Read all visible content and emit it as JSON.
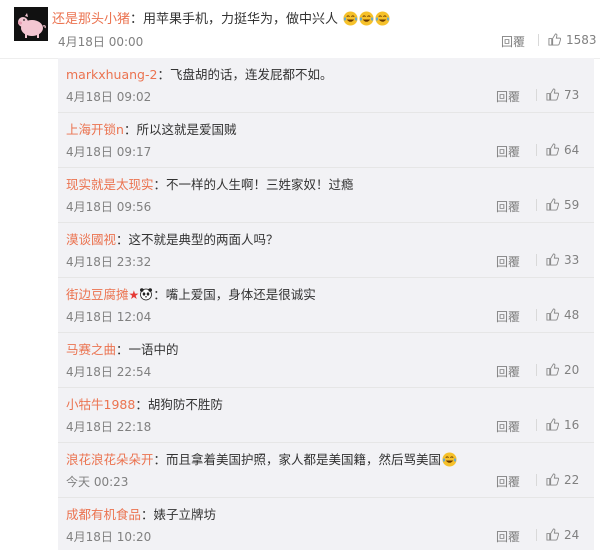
{
  "main_comment": {
    "user": "还是那头小猪",
    "text": "：用苹果手机，力挺华为，做中兴人",
    "time": "4月18日 00:00",
    "reply_label": "回覆",
    "likes": "1583",
    "avatar_icon": "pig-avatar-icon",
    "emoji_icon": "laugh-cry-emoji-icon",
    "emoji_count": 3
  },
  "replies": [
    {
      "user": "markxhuang-2",
      "text": "：飞盘胡的话，连发屁都不如。",
      "time": "4月18日 09:02",
      "reply_label": "回覆",
      "likes": "73"
    },
    {
      "user": "上海开锁n",
      "text": "：所以这就是爱国贼",
      "time": "4月18日 09:17",
      "reply_label": "回覆",
      "likes": "64"
    },
    {
      "user": "现实就是太现实",
      "text": "：不一样的人生啊！三姓家奴！过瘾",
      "time": "4月18日 09:56",
      "reply_label": "回覆",
      "likes": "59"
    },
    {
      "user": "漠谈國视",
      "text": "：这不就是典型的两面人吗？",
      "time": "4月18日 23:32",
      "reply_label": "回覆",
      "likes": "33"
    },
    {
      "user": "街边豆腐摊",
      "badges": [
        "star-badge-icon",
        "panda-badge-icon"
      ],
      "text": "：嘴上爱国，身体还是很诚实",
      "time": "4月18日 12:04",
      "reply_label": "回覆",
      "likes": "48"
    },
    {
      "user": "马赛之曲",
      "text": "：一语中的",
      "time": "4月18日 22:54",
      "reply_label": "回覆",
      "likes": "20"
    },
    {
      "user": "小牯牛1988",
      "text": "：胡狗防不胜防",
      "time": "4月18日 22:18",
      "reply_label": "回覆",
      "likes": "16"
    },
    {
      "user": "浪花浪花朵朵开",
      "text": "：而且拿着美国护照，家人都是美国籍，然后骂美国",
      "emoji_icon": "laugh-cry-emoji-icon",
      "time": "今天 00:23",
      "reply_label": "回覆",
      "likes": "22"
    },
    {
      "user": "成都有机食品",
      "text": "：婊子立牌坊",
      "time": "4月18日 10:20",
      "reply_label": "回覆",
      "likes": "24"
    }
  ],
  "colors": {
    "username": "#eb7350",
    "meta": "#808080",
    "panel_bg": "#f2f2f5"
  }
}
